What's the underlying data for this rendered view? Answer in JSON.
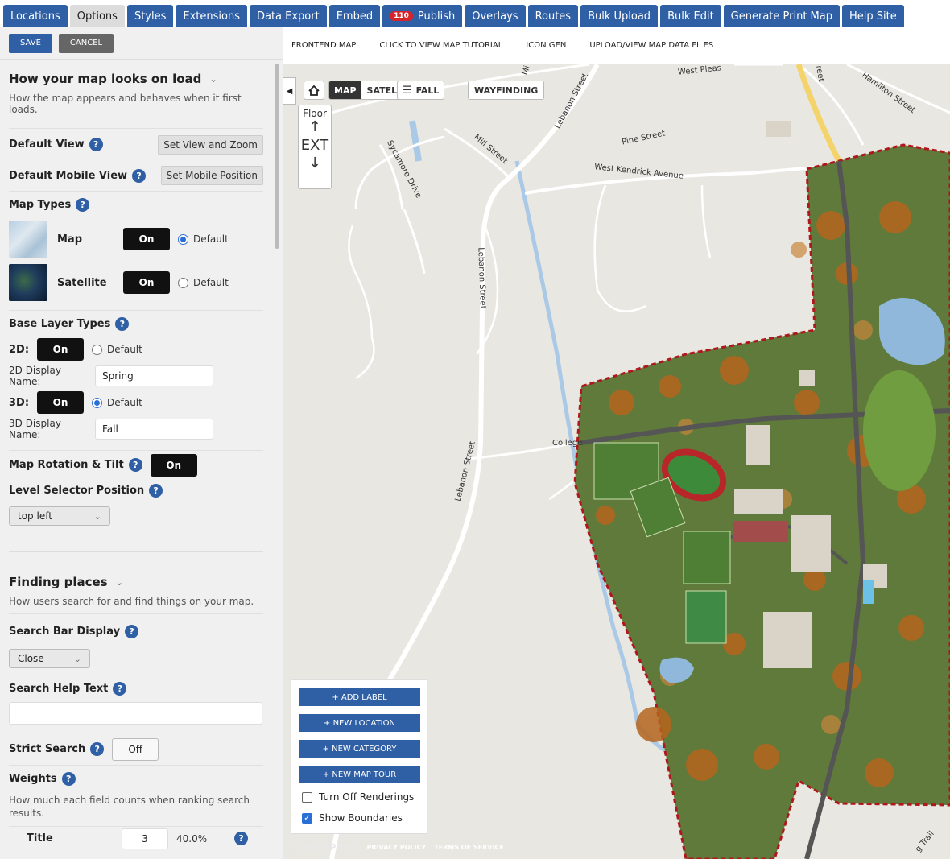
{
  "tabs": [
    {
      "label": "Locations",
      "active": false
    },
    {
      "label": "Options",
      "active": true
    },
    {
      "label": "Styles",
      "active": false
    },
    {
      "label": "Extensions",
      "active": false
    },
    {
      "label": "Data Export",
      "active": false
    },
    {
      "label": "Embed",
      "active": false
    },
    {
      "label": "Publish",
      "active": false,
      "badge": "110"
    },
    {
      "label": "Overlays",
      "active": false
    },
    {
      "label": "Routes",
      "active": false
    },
    {
      "label": "Bulk Upload",
      "active": false
    },
    {
      "label": "Bulk Edit",
      "active": false
    },
    {
      "label": "Generate Print Map",
      "active": false
    },
    {
      "label": "Help Site",
      "active": false
    }
  ],
  "panel": {
    "save_label": "SAVE",
    "cancel_label": "CANCEL",
    "load": {
      "title": "How your map looks on load",
      "desc": "How the map appears and behaves when it first loads.",
      "default_view_label": "Default View",
      "default_view_btn": "Set View and Zoom",
      "mobile_view_label": "Default Mobile View",
      "mobile_view_btn": "Set Mobile Position",
      "map_types_label": "Map Types",
      "map_type_map": "Map",
      "map_type_satellite": "Satellite",
      "on": "On",
      "off": "Off",
      "default": "Default",
      "base_layer_label": "Base Layer Types",
      "twod_label": "2D:",
      "twod_name_label": "2D Display Name:",
      "twod_name_value": "Spring",
      "threed_label": "3D:",
      "threed_name_label": "3D Display Name:",
      "threed_name_value": "Fall",
      "rotation_label": "Map Rotation & Tilt",
      "level_selector_label": "Level Selector Position",
      "level_selector_value": "top left"
    },
    "finding": {
      "title": "Finding places",
      "desc": "How users search for and find things on your map.",
      "search_bar_label": "Search Bar Display",
      "search_bar_value": "Close",
      "help_text_label": "Search Help Text",
      "help_text_value": "",
      "strict_label": "Strict Search",
      "weights_label": "Weights",
      "weights_desc": "How much each field counts when ranking search results.",
      "title_field": "Title",
      "title_weight": "3",
      "title_pct": "40.0%"
    }
  },
  "subbar": [
    "FRONTEND MAP",
    "CLICK TO VIEW MAP TUTORIAL",
    "ICON GEN",
    "UPLOAD/VIEW MAP DATA FILES"
  ],
  "map": {
    "home_icon": "home-icon",
    "map_btn": "MAP",
    "satellite_btn": "SATELLITE",
    "layers_btn": "FALL",
    "wayfinding_btn": "WAYFINDING",
    "floor_label": "Floor",
    "floor_value": "EXT",
    "tools": [
      "+ ADD LABEL",
      "+ NEW LOCATION",
      "+ NEW CATEGORY",
      "+ NEW MAP TOUR"
    ],
    "turn_off_renderings": "Turn Off Renderings",
    "show_boundaries": "Show Boundaries",
    "brand": "CONCEPT3D",
    "privacy": "PRIVACY POLICY",
    "terms": "TERMS OF SERVICE",
    "streets": {
      "west_pleasant": "West Pleas",
      "lebanon_top": "Lebanon Street",
      "hamilton": "Hamilton Street",
      "mill": "Mill Street",
      "sycamore": "Sycamore Drive",
      "pine": "Pine Street",
      "west_kendrick": "West Kendrick Avenue",
      "lebanon_mid": "Lebanon Street",
      "lebanon_low": "Lebanon Street",
      "college": "College",
      "trail": "g Trail",
      "street_frag": "reet",
      "mi_frag": "Mi"
    },
    "accent": "#2f5fa5",
    "boundary_color": "#b0161c"
  }
}
